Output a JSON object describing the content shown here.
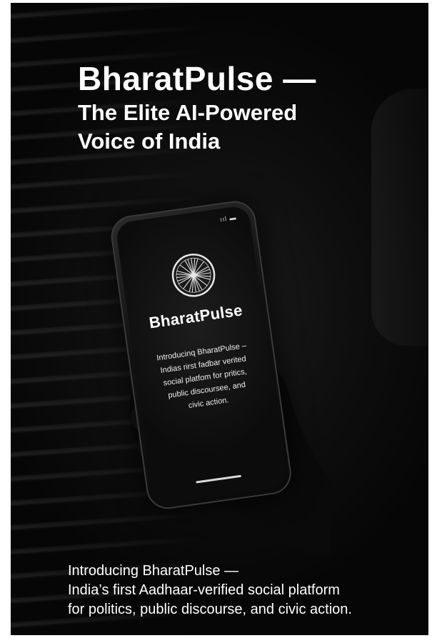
{
  "headline": {
    "brand": "BharatPulse —",
    "subline_1": "The Elite AI-Powered",
    "subline_2": "Voice of India"
  },
  "phone": {
    "status": "ııl ▬",
    "logo_icon": "ashoka-chakra-icon",
    "app_name": "BharatPulse",
    "intro_lines": "Introducinq BharatPulse –\nIndias rirst fadbar verited\nsocial platfom for pritics,\npublic discoursee, and\ncivic action."
  },
  "footer": {
    "line_1": "Introducing BharatPulse —",
    "line_2": "India’s first Aadhaar-verified social platform",
    "line_3": "for politics, public discourse, and civic action."
  },
  "colors": {
    "background": "#0e0e0e",
    "text": "#ffffff",
    "accent_white": "#ffffff"
  }
}
